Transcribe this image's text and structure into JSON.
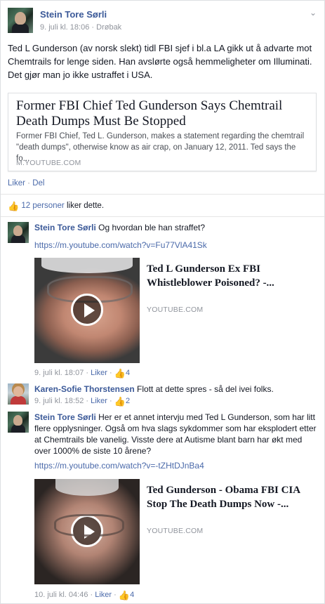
{
  "post": {
    "author": "Stein Tore Sørli",
    "time": "9. juli kl. 18:06",
    "place": "Drøbak",
    "text": "Ted L Gunderson (av norsk slekt) tidl FBI sjef i bl.a LA gikk ut å advarte mot Chemtrails for lenge siden. Han avslørte også hemmeligheter om Illuminati. Det gjør man jo ikke ustraffet i USA.",
    "link": {
      "title": "Former FBI Chief Ted Gunderson Says Chemtrail Death Dumps Must Be Stopped",
      "description": "Former FBI Chief, Ted L. Gunderson, makes a statement regarding the chemtrail \"death dumps\", otherwise know as air crap, on January 12, 2011. Ted says the fo...",
      "source": "M.YOUTUBE.COM"
    },
    "actions": {
      "like": "Liker",
      "sep": "·",
      "share": "Del"
    },
    "likes": {
      "count": "12 personer",
      "suffix": " liker dette."
    }
  },
  "comments": [
    {
      "author": "Stein Tore Sørli",
      "text": "Og hvordan ble han straffet?",
      "url": "https://m.youtube.com/watch?v=Fu77VlA41Sk",
      "video": {
        "title": "Ted L Gunderson Ex FBI Whistleblower Poisoned? -...",
        "source": "YOUTUBE.COM"
      },
      "time": "9. juli kl. 18:07",
      "like_label": "Liker",
      "like_count": "4"
    },
    {
      "author": "Karen-Sofie Thorstensen",
      "text": "Flott at dette spres - så del ivei folks.",
      "time": "9. juli kl. 18:52",
      "like_label": "Liker",
      "like_count": "2"
    },
    {
      "author": "Stein Tore Sørli",
      "text": "Her er et annet intervju med Ted L Gunderson, som har litt flere opplysninger. Også om hva slags sykdommer som har eksplodert etter at Chemtrails ble vanelig. Visste dere at Autisme blant barn har økt med over 1000% de siste 10 årene?",
      "url": "https://m.youtube.com/watch?v=-tZHtDJnBa4",
      "video": {
        "title": "Ted Gunderson - Obama FBI CIA Stop The Death Dumps Now -...",
        "source": "YOUTUBE.COM"
      },
      "time": "10. juli kl. 04:46",
      "like_label": "Liker",
      "like_count": "4"
    }
  ],
  "icons": {
    "chevron": "chevron-down-icon",
    "thumb": "thumbs-up-icon",
    "play": "play-icon"
  },
  "colors": {
    "link": "#3b5998",
    "muted": "#90949c",
    "thumb": "#5b7bd5"
  }
}
